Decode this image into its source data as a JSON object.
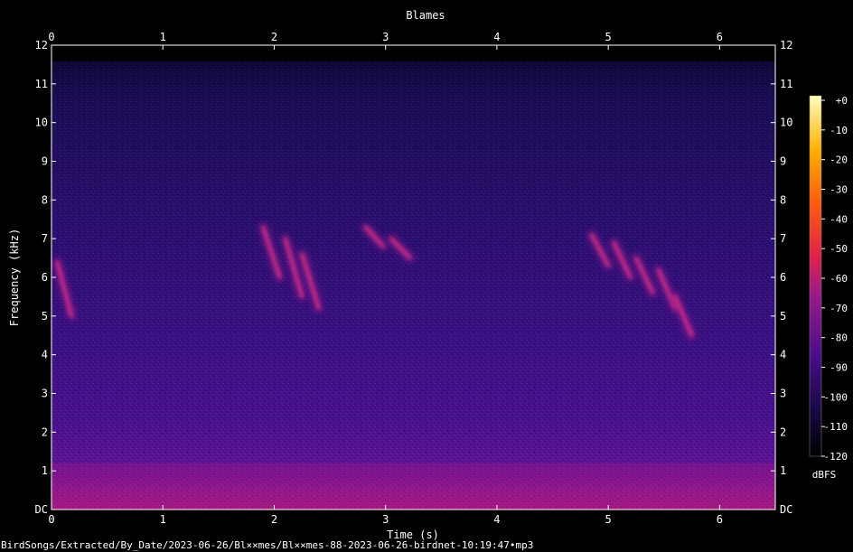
{
  "chart_data": {
    "type": "heatmap",
    "title": "Blames",
    "xlabel": "Time (s)",
    "ylabel": "Frequency (kHz)",
    "xlim": [
      0,
      6.5
    ],
    "ylim": [
      0,
      12
    ],
    "x_ticks": [
      "0",
      "1",
      "2",
      "3",
      "4",
      "5",
      "6"
    ],
    "y_ticks": [
      "DC",
      "1",
      "2",
      "3",
      "4",
      "5",
      "6",
      "7",
      "8",
      "9",
      "10",
      "11",
      "12"
    ],
    "colorbar": {
      "label": "dBFS",
      "range": [
        -120,
        0
      ],
      "ticks": [
        "+0",
        "-10",
        "-20",
        "-30",
        "-40",
        "-50",
        "-60",
        "-70",
        "-80",
        "-90",
        "-100",
        "-110",
        "-120"
      ],
      "colors": [
        "#000000",
        "#1a0a4a",
        "#4b0c8a",
        "#9a1a8a",
        "#e0204a",
        "#ff5a10",
        "#ffb000",
        "#ffffc0"
      ]
    },
    "background_level_dbfs": -100,
    "low_freq_band": {
      "freq_range_khz": [
        0,
        1.2
      ],
      "level_dbfs": -75
    },
    "calls": [
      {
        "t": [
          0.05,
          0.18
        ],
        "f": [
          6.4,
          5.0
        ],
        "level_dbfs": -70
      },
      {
        "t": [
          1.9,
          2.05
        ],
        "f": [
          7.3,
          6.0
        ],
        "level_dbfs": -70
      },
      {
        "t": [
          2.1,
          2.25
        ],
        "f": [
          7.0,
          5.5
        ],
        "level_dbfs": -70
      },
      {
        "t": [
          2.25,
          2.4
        ],
        "f": [
          6.6,
          5.2
        ],
        "level_dbfs": -72
      },
      {
        "t": [
          2.82,
          2.98
        ],
        "f": [
          7.3,
          6.8
        ],
        "level_dbfs": -68
      },
      {
        "t": [
          3.05,
          3.22
        ],
        "f": [
          7.0,
          6.5
        ],
        "level_dbfs": -70
      },
      {
        "t": [
          4.85,
          5.0
        ],
        "f": [
          7.1,
          6.3
        ],
        "level_dbfs": -70
      },
      {
        "t": [
          5.05,
          5.2
        ],
        "f": [
          6.9,
          6.0
        ],
        "level_dbfs": -70
      },
      {
        "t": [
          5.25,
          5.4
        ],
        "f": [
          6.5,
          5.6
        ],
        "level_dbfs": -72
      },
      {
        "t": [
          5.45,
          5.6
        ],
        "f": [
          6.2,
          5.2
        ],
        "level_dbfs": -72
      },
      {
        "t": [
          5.6,
          5.75
        ],
        "f": [
          5.5,
          4.5
        ],
        "level_dbfs": -74
      }
    ]
  },
  "filepath": "BirdSongs/Extracted/By_Date/2023-06-26/Bl××mes/Bl××mes-88-2023-06-26-birdnet-10:19:47•mp3"
}
